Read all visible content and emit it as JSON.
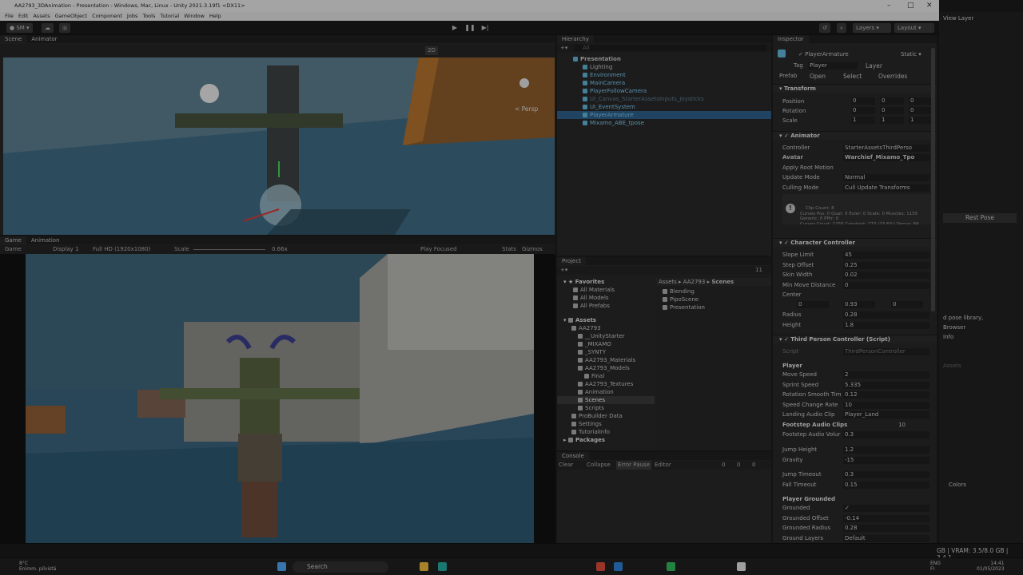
{
  "window": {
    "title": "AA2793_3DAnimation - Presentation - Windows, Mac, Linux - Unity 2021.3.19f1 <DX11>"
  },
  "menu": [
    "File",
    "Edit",
    "Assets",
    "GameObject",
    "Component",
    "Jobs",
    "Tools",
    "Tutorial",
    "Window",
    "Help"
  ],
  "toolbar": {
    "account": "SM",
    "layers": "Layers",
    "layout": "Layout",
    "view_layer": "View Layer"
  },
  "scene": {
    "tabs": [
      "Scene",
      "Animator"
    ],
    "mode_2d": "2D",
    "persp": "< Persp"
  },
  "game": {
    "tabs": [
      "Game",
      "Animation"
    ],
    "mode": "Game",
    "display": "Display 1",
    "resolution": "Full HD (1920x1080)",
    "scale_label": "Scale",
    "scale_value": "0.66x",
    "play_focused": "Play Focused",
    "stats": "Stats",
    "gizmos": "Gizmos"
  },
  "hierarchy": {
    "tab": "Hierarchy",
    "search_placeholder": "All",
    "items": [
      {
        "label": "Presentation",
        "level": 0,
        "kind": "scene"
      },
      {
        "label": "Lighting",
        "level": 1,
        "kind": "go"
      },
      {
        "label": "Environment",
        "level": 1,
        "kind": "prefab"
      },
      {
        "label": "MainCamera",
        "level": 1,
        "kind": "prefab"
      },
      {
        "label": "PlayerFollowCamera",
        "level": 1,
        "kind": "prefab"
      },
      {
        "label": "UI_Canvas_StarterAssetsInputs_Joysticks",
        "level": 1,
        "kind": "dim"
      },
      {
        "label": "UI_EventSystem",
        "level": 1,
        "kind": "prefab"
      },
      {
        "label": "PlayerArmature",
        "level": 1,
        "kind": "selected"
      },
      {
        "label": "Mixamo_ABE_tpose",
        "level": 1,
        "kind": "prefab"
      }
    ]
  },
  "project": {
    "tab": "Project",
    "favorites_label": "Favorites",
    "favorites": [
      "All Materials",
      "All Models",
      "All Prefabs"
    ],
    "assets_label": "Assets",
    "tree": [
      "AA2793",
      "__UnityStarter",
      "_MIXAMO",
      "_SYNTY",
      "AA2793_Materials",
      "AA2793_Models",
      "Final",
      "AA2793_Textures",
      "Animation",
      "Scenes",
      "Scripts",
      "ProBuilder Data",
      "Settings",
      "TutorialInfo"
    ],
    "packages_label": "Packages",
    "breadcrumb": [
      "Assets",
      "AA2793",
      "Scenes"
    ],
    "files": [
      "Blending",
      "PipoScene",
      "Presentation"
    ],
    "count": "11"
  },
  "console": {
    "tab": "Console",
    "clear": "Clear",
    "collapse": "Collapse",
    "error_pause": "Error Pause",
    "editor": "Editor",
    "counts": [
      "0",
      "0",
      "0"
    ]
  },
  "inspector": {
    "tab": "Inspector",
    "object_name": "PlayerArmature",
    "static_label": "Static",
    "tag_label": "Tag",
    "tag": "Player",
    "layer_label": "Layer",
    "layer": "Default",
    "prefab_label": "Prefab",
    "open": "Open",
    "select": "Select",
    "overrides": "Overrides",
    "transform": {
      "title": "Transform",
      "position": "Position",
      "rotation": "Rotation",
      "scale": "Scale",
      "pos": [
        "0",
        "0",
        "0"
      ],
      "rot": [
        "0",
        "0",
        "0"
      ],
      "scl": [
        "1",
        "1",
        "1"
      ]
    },
    "animator": {
      "title": "Animator",
      "controller_label": "Controller",
      "controller": "StarterAssetsThirdPerso",
      "avatar_label": "Avatar",
      "avatar": "Warchief_Mixamo_Tpo",
      "apply_root": "Apply Root Motion",
      "update_mode_label": "Update Mode",
      "update_mode": "Normal",
      "culling_label": "Culling Mode",
      "culling": "Cull Update Transforms",
      "info": "Clip Count: 8\nCurves Pos: 0 Quat: 0 Euler: 0 Scale: 0 Muscles: 1155 Generic: 0 PPtr: 0\nCurves Count: 1155 Constant: 273 (23.6%) Dense: 84 (8.1%) Stream: 798 (67.9%)"
    },
    "character_controller": {
      "title": "Character Controller",
      "rows": [
        [
          "Slope Limit",
          "45"
        ],
        [
          "Step Offset",
          "0.25"
        ],
        [
          "Skin Width",
          "0.02"
        ],
        [
          "Min Move Distance",
          "0"
        ]
      ],
      "center_label": "Center",
      "center": [
        "0",
        "0.93",
        "0"
      ],
      "radius_label": "Radius",
      "radius": "0.28",
      "height_label": "Height",
      "height": "1.8"
    },
    "tpc": {
      "title": "Third Person Controller (Script)",
      "script_label": "Script",
      "script": "ThirdPersonController",
      "player_label": "Player",
      "rows": [
        [
          "Move Speed",
          "2"
        ],
        [
          "Sprint Speed",
          "5.335"
        ],
        [
          "Rotation Smooth Tim",
          "0.12"
        ],
        [
          "Speed Change Rate",
          "10"
        ],
        [
          "Landing Audio Clip",
          "Player_Land"
        ],
        [
          "Footstep Audio Clips",
          "10"
        ],
        [
          "Footstep Audio Volur",
          "0.3"
        ],
        [
          "Jump Height",
          "1.2"
        ],
        [
          "Gravity",
          "-15"
        ],
        [
          "Jump Timeout",
          "0.3"
        ],
        [
          "Fall Timeout",
          "0.15"
        ]
      ],
      "grounded_header": "Player Grounded",
      "grounded_rows": [
        [
          "Grounded",
          "✓"
        ],
        [
          "Grounded Offset",
          "-0.14"
        ],
        [
          "Grounded Radius",
          "0.28"
        ],
        [
          "Ground Layers",
          "Default"
        ]
      ]
    }
  },
  "right_panel": {
    "rest_pose": "Rest Pose",
    "pose_library": "d pose library,",
    "browser": "Browser",
    "info": "Info",
    "colors": "Colors",
    "assets": "Assets"
  },
  "status": {
    "vram": "GB | VRAM: 3.5/8.0 GB | 3.4.1"
  },
  "taskbar": {
    "weather_temp": "8°C",
    "weather_desc": "Enimm. pilvistä",
    "search": "Search",
    "lang": "ENG\nFI",
    "time": "14:41",
    "date": "01/05/2023"
  }
}
